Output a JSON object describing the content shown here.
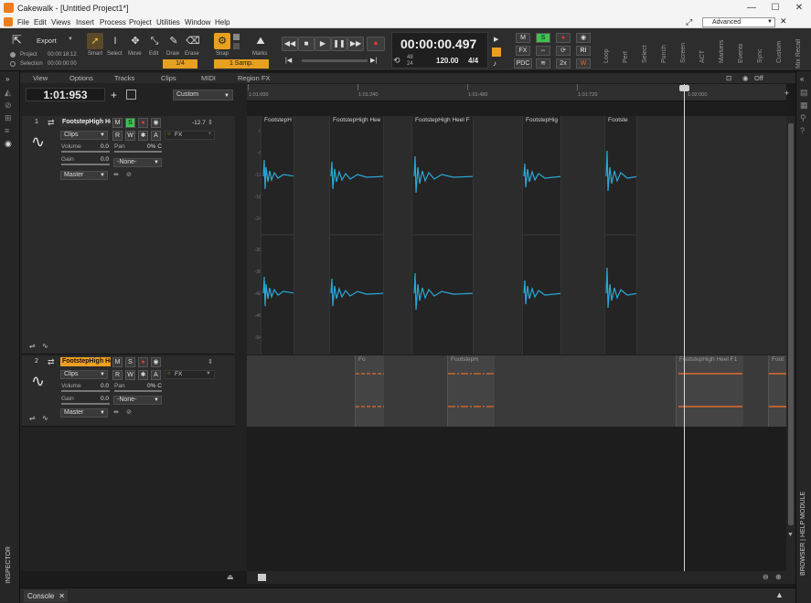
{
  "window": {
    "title": "Cakewalk - [Untitled Project1*]",
    "controls": [
      "—",
      "☐",
      "✕"
    ]
  },
  "menu": {
    "items": [
      "File",
      "Edit",
      "Views",
      "Insert",
      "Process",
      "Project",
      "Utilities",
      "Window",
      "Help"
    ],
    "workspace": "Advanced"
  },
  "control_bar": {
    "export_label": "Export",
    "project_label": "Project",
    "project_time": "00:00:18:12",
    "selection_label": "Selection",
    "selection_time": "00:00:00:00",
    "tools": [
      "Smart",
      "Select",
      "Move",
      "Edit",
      "Draw",
      "Erase"
    ],
    "snap_label": "Snap",
    "marks_label": "Marks",
    "snap_value": "1/4",
    "snap_samples": "1 Samp.",
    "time_display": "00:00:00.497",
    "meter_top": "48",
    "meter_bottom": "24",
    "tempo": "120.00",
    "time_signature": "4/4",
    "mix_buttons": [
      "M",
      "S",
      "●",
      "◉"
    ],
    "fx_buttons": [
      "FX",
      "⇔",
      "⟳",
      "RI"
    ],
    "pdc_label": "PDC",
    "pdc_value": "2x",
    "modules": [
      "Loop",
      "Perf",
      "Select",
      "Punch",
      "Screen",
      "ACT",
      "Markers",
      "Events",
      "Sync",
      "Custom",
      "Mix Recall"
    ]
  },
  "track_view": {
    "menus": [
      "View",
      "Options",
      "Tracks",
      "Clips",
      "MIDI",
      "Region FX"
    ],
    "now_time": "1:01:953",
    "preset": "Custom",
    "ruler_ticks": [
      "1:01:000",
      "1:01:240",
      "1:01:480",
      "1:01:720",
      "1:02:000"
    ],
    "zoom_off": "Off"
  },
  "tracks": [
    {
      "number": "1",
      "name": "FootstepHigh He",
      "peak": "-12.7",
      "clips_dd": "Clips",
      "volume_label": "Volume",
      "volume_value": "0.0",
      "pan_label": "Pan",
      "pan_value": "0% C",
      "gain_label": "Gain",
      "gain_value": "0.0",
      "input": "-None-",
      "output": "Master",
      "fx_label": "FX",
      "buttons": [
        "M",
        "S",
        "●",
        "◉"
      ],
      "row2": [
        "R",
        "W",
        "✱",
        "A"
      ]
    },
    {
      "number": "2",
      "name": "FootstepHigh He",
      "clips_dd": "Clips",
      "volume_label": "Volume",
      "volume_value": "0.0",
      "pan_label": "Pan",
      "pan_value": "0% C",
      "gain_label": "Gain",
      "gain_value": "0.0",
      "input": "-None-",
      "output": "Master",
      "fx_label": "FX",
      "buttons": [
        "M",
        "S",
        "●",
        "◉"
      ],
      "row2": [
        "R",
        "W",
        "✱",
        "A"
      ]
    }
  ],
  "clips_track1": [
    "FootstepH",
    "FootstepHigh Hee",
    "FootstepHigh Heel F",
    "FootstepHig",
    "Footste"
  ],
  "clips_track2": [
    "Fo",
    "FootstepH",
    "FootstepHigh Heel F1",
    "Foot"
  ],
  "db_scale": [
    "0",
    "-6",
    "-12",
    "-18",
    "-24",
    "-30",
    "-36",
    "-42",
    "-48",
    "-54"
  ],
  "bottom": {
    "console_tab": "Console",
    "inspector_label": "INSPECTOR",
    "browser_label": "BROWSER | HELP MODULE"
  },
  "colors": {
    "waveform": "#2aa8d8",
    "automation": "#e06a2c",
    "solo_active": "#3ec14d",
    "accent": "#f0a020"
  }
}
